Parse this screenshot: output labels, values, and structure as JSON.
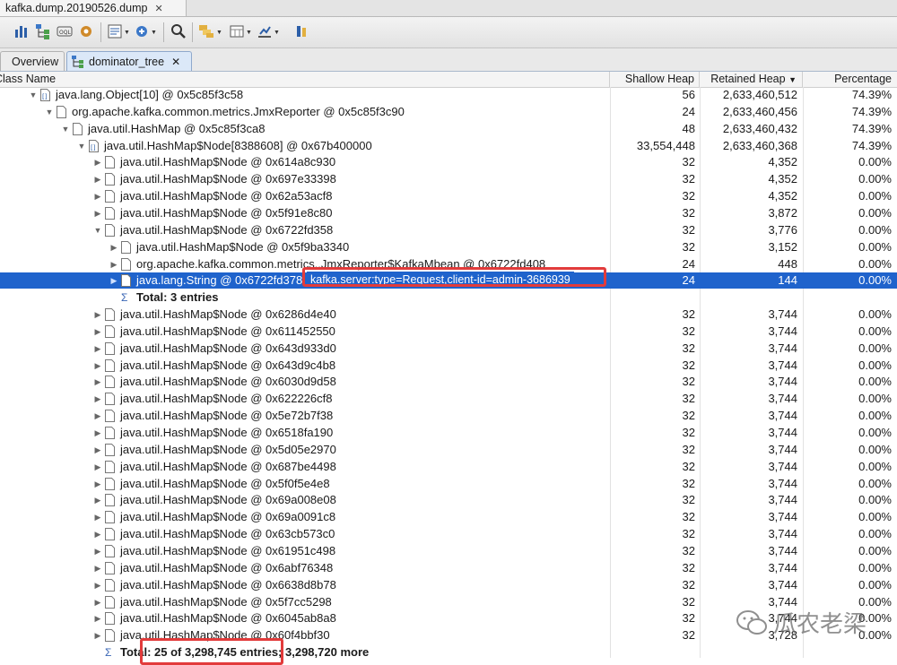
{
  "editor_tab": {
    "title": "kafka.dump.20190526.dump",
    "close": "✕"
  },
  "toolbar": {
    "icons": [
      "histogram-icon",
      "dominator-tree-icon",
      "oql-icon",
      "thread-overview-icon",
      "reports-icon",
      "query-browser-icon",
      "search-icon",
      "group-icon",
      "calculator-icon",
      "export-icon",
      "pin-icon"
    ]
  },
  "view_tabs": {
    "overview": "Overview",
    "dominator_tree": "dominator_tree",
    "close": "✕"
  },
  "columns": {
    "name": "Class Name",
    "shallow": "Shallow Heap",
    "retained": "Retained Heap",
    "percentage": "Percentage"
  },
  "rows": [
    {
      "twisty": "▼",
      "name": "java.lang.Object[10] @ 0x5c85f3c58",
      "shallow": "56",
      "retained": "2,633,460,512",
      "pct": "74.39%"
    },
    {
      "twisty": "▼",
      "name": "org.apache.kafka.common.metrics.JmxReporter @ 0x5c85f3c90",
      "shallow": "24",
      "retained": "2,633,460,456",
      "pct": "74.39%"
    },
    {
      "twisty": "▼",
      "name": "java.util.HashMap @ 0x5c85f3ca8",
      "shallow": "48",
      "retained": "2,633,460,432",
      "pct": "74.39%"
    },
    {
      "twisty": "▼",
      "name": "java.util.HashMap$Node[8388608] @ 0x67b400000",
      "shallow": "33,554,448",
      "retained": "2,633,460,368",
      "pct": "74.39%"
    },
    {
      "twisty": "▶",
      "name": "java.util.HashMap$Node @ 0x614a8c930",
      "shallow": "32",
      "retained": "4,352",
      "pct": "0.00%"
    },
    {
      "twisty": "▶",
      "name": "java.util.HashMap$Node @ 0x697e33398",
      "shallow": "32",
      "retained": "4,352",
      "pct": "0.00%"
    },
    {
      "twisty": "▶",
      "name": "java.util.HashMap$Node @ 0x62a53acf8",
      "shallow": "32",
      "retained": "4,352",
      "pct": "0.00%"
    },
    {
      "twisty": "▶",
      "name": "java.util.HashMap$Node @ 0x5f91e8c80",
      "shallow": "32",
      "retained": "3,872",
      "pct": "0.00%"
    },
    {
      "twisty": "▼",
      "name": "java.util.HashMap$Node @ 0x6722fd358",
      "shallow": "32",
      "retained": "3,776",
      "pct": "0.00%"
    },
    {
      "twisty": "▶",
      "name": "java.util.HashMap$Node @ 0x5f9ba3340",
      "shallow": "32",
      "retained": "3,152",
      "pct": "0.00%"
    },
    {
      "twisty": "▶",
      "name": "org.apache.kafka.common.metrics..JmxReporter$KafkaMbean @ 0x6722fd408",
      "shallow": "24",
      "retained": "448",
      "pct": "0.00%"
    },
    {
      "twisty": "▶",
      "name": "java.lang.String @ 0x6722fd378",
      "shallow": "24",
      "retained": "144",
      "pct": "0.00%"
    },
    {
      "twisty": "",
      "name": "Total: 3 entries",
      "shallow": "",
      "retained": "",
      "pct": ""
    },
    {
      "twisty": "▶",
      "name": "java.util.HashMap$Node @ 0x6286d4e40",
      "shallow": "32",
      "retained": "3,744",
      "pct": "0.00%"
    },
    {
      "twisty": "▶",
      "name": "java.util.HashMap$Node @ 0x611452550",
      "shallow": "32",
      "retained": "3,744",
      "pct": "0.00%"
    },
    {
      "twisty": "▶",
      "name": "java.util.HashMap$Node @ 0x643d933d0",
      "shallow": "32",
      "retained": "3,744",
      "pct": "0.00%"
    },
    {
      "twisty": "▶",
      "name": "java.util.HashMap$Node @ 0x643d9c4b8",
      "shallow": "32",
      "retained": "3,744",
      "pct": "0.00%"
    },
    {
      "twisty": "▶",
      "name": "java.util.HashMap$Node @ 0x6030d9d58",
      "shallow": "32",
      "retained": "3,744",
      "pct": "0.00%"
    },
    {
      "twisty": "▶",
      "name": "java.util.HashMap$Node @ 0x622226cf8",
      "shallow": "32",
      "retained": "3,744",
      "pct": "0.00%"
    },
    {
      "twisty": "▶",
      "name": "java.util.HashMap$Node @ 0x5e72b7f38",
      "shallow": "32",
      "retained": "3,744",
      "pct": "0.00%"
    },
    {
      "twisty": "▶",
      "name": "java.util.HashMap$Node @ 0x6518fa190",
      "shallow": "32",
      "retained": "3,744",
      "pct": "0.00%"
    },
    {
      "twisty": "▶",
      "name": "java.util.HashMap$Node @ 0x5d05e2970",
      "shallow": "32",
      "retained": "3,744",
      "pct": "0.00%"
    },
    {
      "twisty": "▶",
      "name": "java.util.HashMap$Node @ 0x687be4498",
      "shallow": "32",
      "retained": "3,744",
      "pct": "0.00%"
    },
    {
      "twisty": "▶",
      "name": "java.util.HashMap$Node @ 0x5f0f5e4e8",
      "shallow": "32",
      "retained": "3,744",
      "pct": "0.00%"
    },
    {
      "twisty": "▶",
      "name": "java.util.HashMap$Node @ 0x69a008e08",
      "shallow": "32",
      "retained": "3,744",
      "pct": "0.00%"
    },
    {
      "twisty": "▶",
      "name": "java.util.HashMap$Node @ 0x69a0091c8",
      "shallow": "32",
      "retained": "3,744",
      "pct": "0.00%"
    },
    {
      "twisty": "▶",
      "name": "java.util.HashMap$Node @ 0x63cb573c0",
      "shallow": "32",
      "retained": "3,744",
      "pct": "0.00%"
    },
    {
      "twisty": "▶",
      "name": "java.util.HashMap$Node @ 0x61951c498",
      "shallow": "32",
      "retained": "3,744",
      "pct": "0.00%"
    },
    {
      "twisty": "▶",
      "name": "java.util.HashMap$Node @ 0x6abf76348",
      "shallow": "32",
      "retained": "3,744",
      "pct": "0.00%"
    },
    {
      "twisty": "▶",
      "name": "java.util.HashMap$Node @ 0x6638d8b78",
      "shallow": "32",
      "retained": "3,744",
      "pct": "0.00%"
    },
    {
      "twisty": "▶",
      "name": "java.util.HashMap$Node @ 0x5f7cc5298",
      "shallow": "32",
      "retained": "3,744",
      "pct": "0.00%"
    },
    {
      "twisty": "▶",
      "name": "java.util.HashMap$Node @ 0x6045ab8a8",
      "shallow": "32",
      "retained": "3,744",
      "pct": "0.00%"
    },
    {
      "twisty": "▶",
      "name": "java.util.HashMap$Node @ 0x60f4bbf30",
      "shallow": "32",
      "retained": "3,728",
      "pct": "0.00%"
    },
    {
      "twisty": "",
      "name": "Total: 25 of 3,298,745 entries; 3,298,720 more",
      "shallow": "",
      "retained": "",
      "pct": ""
    }
  ],
  "tooltip": "kafka.server:type=Request,client-id=admin-3686939",
  "watermark": "瓜农老梁",
  "colors": {
    "selection": "#1f63cc",
    "annotation": "#e23b3b"
  }
}
